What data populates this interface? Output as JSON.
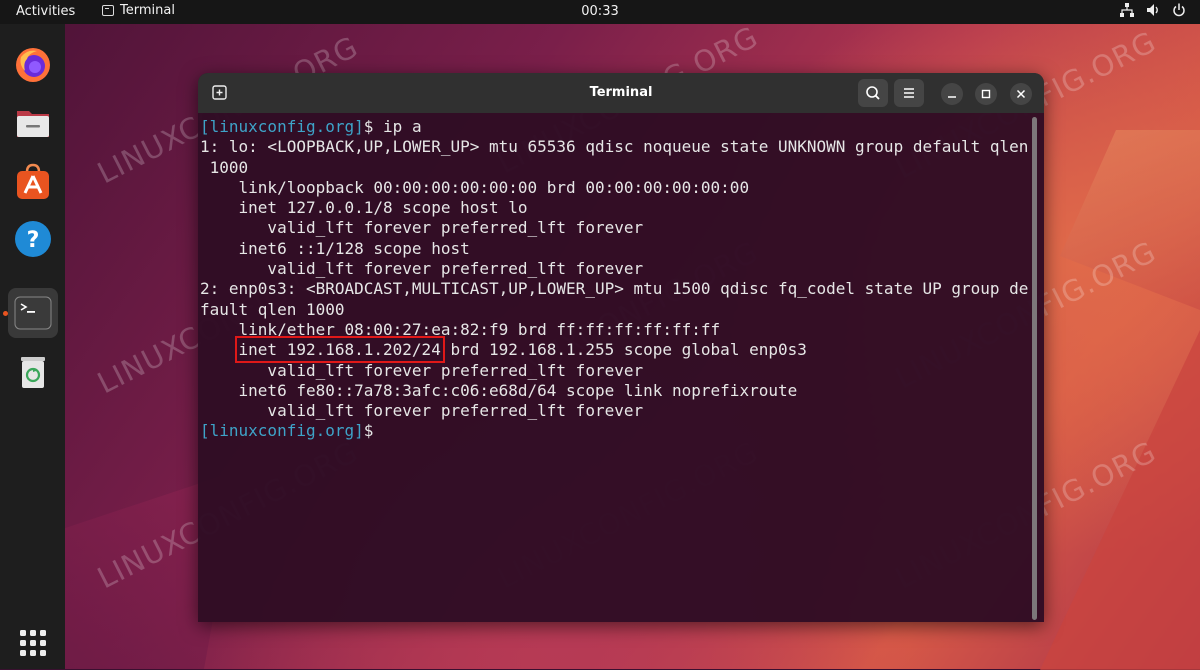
{
  "topbar": {
    "activities": "Activities",
    "app_name": "Terminal",
    "clock": "00:33",
    "tray_icons": [
      "network-icon",
      "volume-icon",
      "power-icon"
    ]
  },
  "dock": {
    "items": [
      "firefox-icon",
      "files-icon",
      "app-center-icon",
      "help-icon",
      "terminal-icon",
      "trash-icon",
      "show-apps-icon"
    ]
  },
  "terminal": {
    "title": "Terminal",
    "prompt_user": "[linuxconfig.org]",
    "prompt_symbol": "$",
    "command": " ip a",
    "lines": [
      "1: lo: <LOOPBACK,UP,LOWER_UP> mtu 65536 qdisc noqueue state UNKNOWN group default qlen",
      " 1000",
      "    link/loopback 00:00:00:00:00:00 brd 00:00:00:00:00:00",
      "    inet 127.0.0.1/8 scope host lo",
      "       valid_lft forever preferred_lft forever",
      "    inet6 ::1/128 scope host",
      "       valid_lft forever preferred_lft forever",
      "2: enp0s3: <BROADCAST,MULTICAST,UP,LOWER_UP> mtu 1500 qdisc fq_codel state UP group de",
      "fault qlen 1000",
      "    link/ether 08:00:27:ea:82:f9 brd ff:ff:ff:ff:ff:ff"
    ],
    "highlight_indent": "    ",
    "highlight_text": "inet 192.168.1.202/24",
    "highlight_rest": " brd 192.168.1.255 scope global enp0s3",
    "lines_after": [
      "       valid_lft forever preferred_lft forever",
      "    inet6 fe80::7a78:3afc:c06:e68d/64 scope link noprefixroute",
      "       valid_lft forever preferred_lft forever"
    ],
    "final_prompt_user": "[linuxconfig.org]",
    "final_prompt_symbol": "$"
  },
  "watermark": "LINUXCONFIG.ORG",
  "colors": {
    "prompt": "#3ea3c8",
    "highlight_box": "#e01818",
    "accent": "#e95420"
  }
}
